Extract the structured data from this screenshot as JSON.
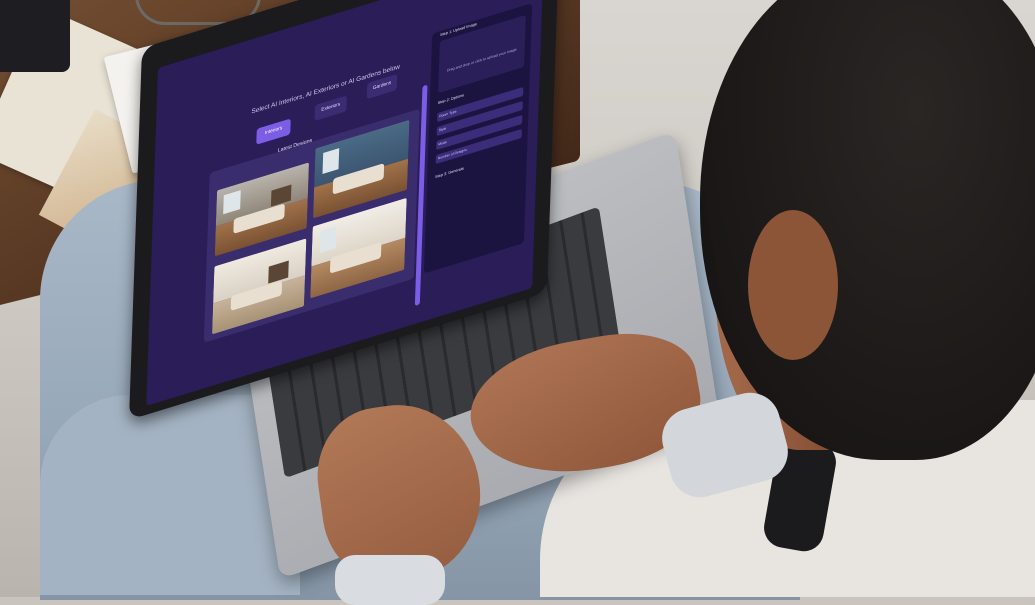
{
  "scene": {
    "description_objects": [
      "coffee-cup",
      "notebook",
      "pen",
      "laptop",
      "hands",
      "person"
    ]
  },
  "screen": {
    "header": "Select AI Interiors, AI Exteriors or AI Gardens below",
    "tabs": [
      {
        "label": "Interiors",
        "active": true
      },
      {
        "label": "Exteriors",
        "active": false
      },
      {
        "label": "Gardens",
        "active": false
      }
    ],
    "gallery_title": "Latest Designs",
    "upload_hint": "Drag and drop or click to upload your image",
    "steps": {
      "step1": "Step 1: Upload Image",
      "step2": "Step 2: Options",
      "step3": "Step 3: Generate"
    },
    "form_rows": [
      "Room Type",
      "Style",
      "Mode",
      "Number of Designs"
    ],
    "colors": {
      "background": "#2a1d58",
      "accent": "#7b5de6",
      "panel": "#1c1440"
    }
  }
}
